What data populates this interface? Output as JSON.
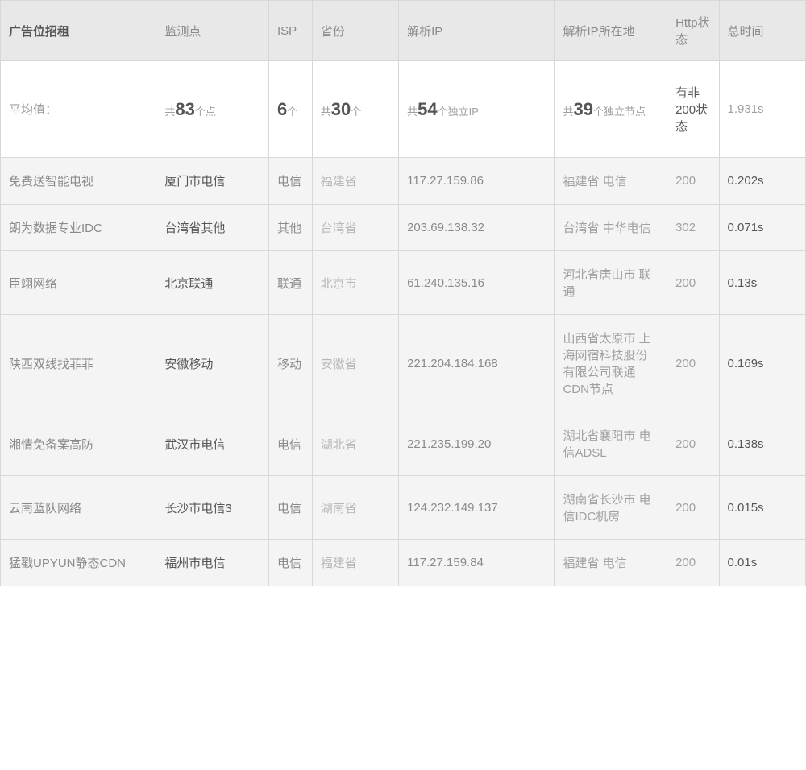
{
  "headers": {
    "ad": "广告位招租",
    "monitor": "监测点",
    "isp": "ISP",
    "province": "省份",
    "ip": "解析IP",
    "iploc": "解析IP所在地",
    "http": "Http状态",
    "time": "总时间"
  },
  "summary": {
    "label": "平均值：",
    "monitor_prefix": "共",
    "monitor_num": "83",
    "monitor_suffix": "个点",
    "isp_num": "6",
    "isp_suffix": "个",
    "province_prefix": "共",
    "province_num": "30",
    "province_suffix": "个",
    "ip_prefix": "共",
    "ip_num": "54",
    "ip_suffix": "个独立IP",
    "iploc_prefix": "共",
    "iploc_num": "39",
    "iploc_suffix": "个独立节点",
    "http_note": "有非200状态",
    "time": "1.931s"
  },
  "rows": [
    {
      "ad": "免费送智能电视",
      "monitor": "厦门市电信",
      "isp": "电信",
      "province": "福建省",
      "ip": "117.27.159.86",
      "iploc": "福建省 电信",
      "http": "200",
      "time": "0.202s"
    },
    {
      "ad": "朗为数据专业IDC",
      "monitor": "台湾省其他",
      "isp": "其他",
      "province": "台湾省",
      "ip": "203.69.138.32",
      "iploc": "台湾省 中华电信",
      "http": "302",
      "time": "0.071s"
    },
    {
      "ad": "臣翊网络",
      "monitor": "北京联通",
      "isp": "联通",
      "province": "北京市",
      "ip": "61.240.135.16",
      "iploc": "河北省唐山市 联通",
      "http": "200",
      "time": "0.13s"
    },
    {
      "ad": "陕西双线找菲菲",
      "monitor": "安徽移动",
      "isp": "移动",
      "province": "安徽省",
      "ip": "221.204.184.168",
      "iploc": "山西省太原市 上海网宿科技股份有限公司联通CDN节点",
      "http": "200",
      "time": "0.169s"
    },
    {
      "ad": "湘情免备案高防",
      "monitor": "武汉市电信",
      "isp": "电信",
      "province": "湖北省",
      "ip": "221.235.199.20",
      "iploc": "湖北省襄阳市 电信ADSL",
      "http": "200",
      "time": "0.138s"
    },
    {
      "ad": "云南蓝队网络",
      "monitor": "长沙市电信3",
      "isp": "电信",
      "province": "湖南省",
      "ip": "124.232.149.137",
      "iploc": "湖南省长沙市 电信IDC机房",
      "http": "200",
      "time": "0.015s"
    },
    {
      "ad": "猛戳UPYUN静态CDN",
      "monitor": "福州市电信",
      "isp": "电信",
      "province": "福建省",
      "ip": "117.27.159.84",
      "iploc": "福建省 电信",
      "http": "200",
      "time": "0.01s"
    }
  ]
}
